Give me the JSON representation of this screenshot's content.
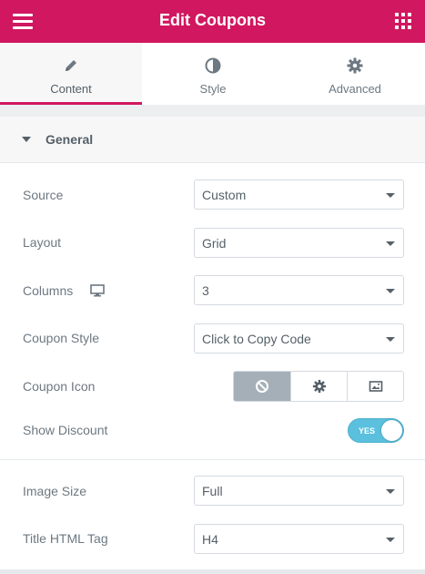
{
  "header": {
    "title": "Edit Coupons"
  },
  "tabs": [
    {
      "label": "Content",
      "icon": "pencil-icon",
      "active": true
    },
    {
      "label": "Style",
      "icon": "contrast-icon",
      "active": false
    },
    {
      "label": "Advanced",
      "icon": "gear-icon",
      "active": false
    }
  ],
  "section": {
    "title": "General"
  },
  "controls": {
    "source": {
      "label": "Source",
      "value": "Custom"
    },
    "layout": {
      "label": "Layout",
      "value": "Grid"
    },
    "columns": {
      "label": "Columns",
      "value": "3"
    },
    "coupon_style": {
      "label": "Coupon Style",
      "value": "Click to Copy Code"
    },
    "coupon_icon": {
      "label": "Coupon Icon",
      "options": [
        "none-icon",
        "gear-icon",
        "image-icon"
      ],
      "selected": "none-icon"
    },
    "show_discount": {
      "label": "Show Discount",
      "toggle_text": "YES",
      "on": true
    },
    "image_size": {
      "label": "Image Size",
      "value": "Full"
    },
    "title_tag": {
      "label": "Title HTML Tag",
      "value": "H4"
    }
  },
  "colors": {
    "accent": "#d1175f",
    "toggle_on": "#5bc0de",
    "selected_icon_bg": "#a4afb7"
  }
}
